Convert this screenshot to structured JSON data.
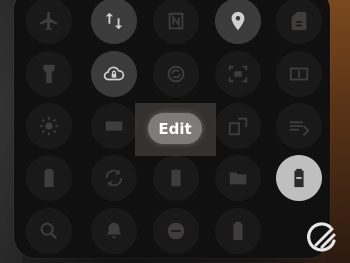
{
  "quick_settings": {
    "edit_label": "Edit",
    "tiles": [
      {
        "icon": "airplane-icon",
        "state": "off"
      },
      {
        "icon": "data-transfer-icon",
        "state": "on"
      },
      {
        "icon": "nfc-icon",
        "state": "off"
      },
      {
        "icon": "location-icon",
        "state": "on"
      },
      {
        "icon": "sim-icon",
        "state": "off"
      },
      {
        "icon": "flashlight-icon",
        "state": "off"
      },
      {
        "icon": "cloud-lock-icon",
        "state": "on"
      },
      {
        "icon": "sync-icon",
        "state": "off"
      },
      {
        "icon": "screenshot-icon",
        "state": "off"
      },
      {
        "icon": "screen-mirror-icon",
        "state": "off"
      },
      {
        "icon": "brightness-icon",
        "state": "off"
      },
      {
        "icon": "keyboard-icon",
        "state": "off"
      },
      {
        "icon": "font-size-icon",
        "state": "off"
      },
      {
        "icon": "cast-icon",
        "state": "off"
      },
      {
        "icon": "battery-saver-icon",
        "state": "off"
      },
      {
        "icon": "refresh-icon",
        "state": "off"
      },
      {
        "icon": "lock-screen-icon",
        "state": "off"
      },
      {
        "icon": "folder-lock-icon",
        "state": "off"
      },
      {
        "icon": "battery-icon",
        "state": "on-bright"
      },
      {
        "icon": "search-icon",
        "state": "off"
      },
      {
        "icon": "bell-icon",
        "state": "off"
      },
      {
        "icon": "do-not-disturb-icon",
        "state": "off"
      },
      {
        "icon": "battery-plus-icon",
        "state": "off"
      }
    ],
    "colors": {
      "panel_bg": "#111010",
      "tile_inactive": "#1a1919",
      "tile_active": "#3b3b3b",
      "tile_bright": "#bfbfbf",
      "edit_pill": "#7d7c7a",
      "accent_edge": "#6b3a18"
    }
  }
}
